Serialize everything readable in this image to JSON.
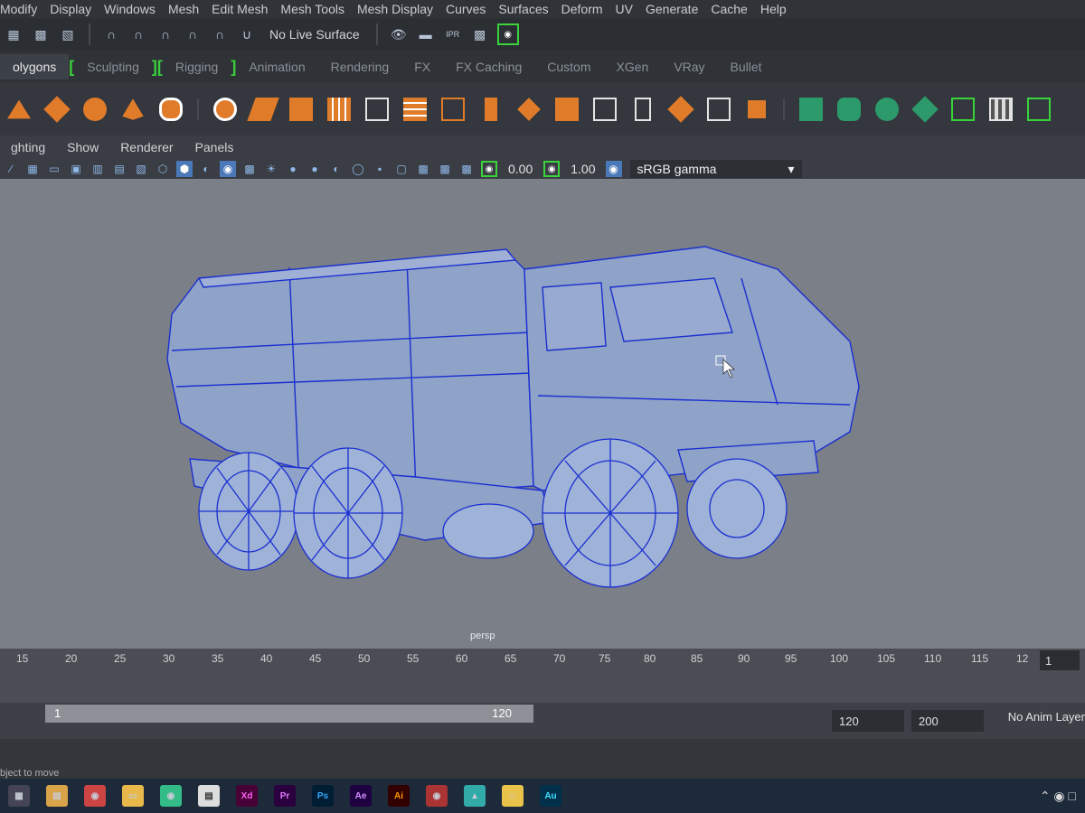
{
  "menubar": {
    "items": [
      "Modify",
      "Display",
      "Windows",
      "Mesh",
      "Edit Mesh",
      "Mesh Tools",
      "Mesh Display",
      "Curves",
      "Surfaces",
      "Deform",
      "UV",
      "Generate",
      "Cache",
      "Help"
    ]
  },
  "statusline": {
    "live_surface": "No Live Surface"
  },
  "shelf_tabs": [
    "olygons",
    "Sculpting",
    "Rigging",
    "Animation",
    "Rendering",
    "FX",
    "FX Caching",
    "Custom",
    "XGen",
    "VRay",
    "Bullet"
  ],
  "panel_menu": [
    "ghting",
    "Show",
    "Renderer",
    "Panels"
  ],
  "panel_toolbar": {
    "exposure_value": "0.00",
    "gamma_value": "1.00",
    "color_space": "sRGB gamma"
  },
  "viewport": {
    "camera_label": "persp"
  },
  "timeline": {
    "ticks": [
      "15",
      "20",
      "25",
      "30",
      "35",
      "40",
      "45",
      "50",
      "55",
      "60",
      "65",
      "70",
      "75",
      "80",
      "85",
      "90",
      "95",
      "100",
      "105",
      "110",
      "115",
      "12"
    ],
    "current_frame": "1"
  },
  "range": {
    "start_value": "1",
    "slider_end": "120",
    "end_time": "120",
    "anim_end": "200",
    "anim_layer": "No Anim Layer"
  },
  "helpline": {
    "text": "bject to move"
  },
  "taskbar": {
    "apps": [
      "Xd",
      "Pr",
      "Ps",
      "Ae",
      "Ai",
      "Au"
    ]
  },
  "colors": {
    "accent_green": "#3ad33c",
    "shelf_orange": "#e07b2a",
    "shelf_green": "#2c9a6a",
    "mesh_wire": "#1a2fd0"
  }
}
